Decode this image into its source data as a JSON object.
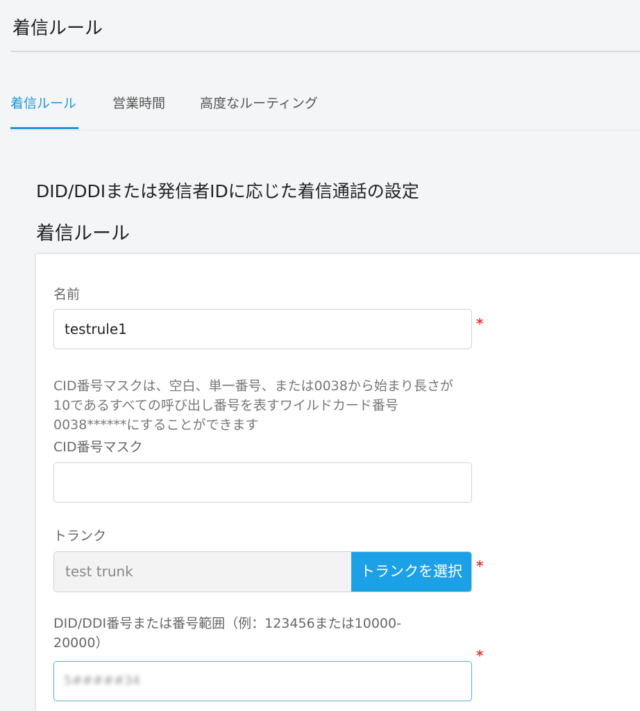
{
  "header": {
    "title": "着信ルール"
  },
  "tabs": [
    {
      "label": "着信ルール",
      "active": true
    },
    {
      "label": "営業時間",
      "active": false
    },
    {
      "label": "高度なルーティング",
      "active": false
    }
  ],
  "section": {
    "description": "DID/DDIまたは発信者IDに応じた着信通話の設定",
    "title": "着信ルール"
  },
  "form": {
    "name": {
      "label": "名前",
      "value": "testrule1",
      "required_mark": "*"
    },
    "cid": {
      "help": "CID番号マスクは、空白、単一番号、または0038から始まり長さが10であるすべての呼び出し番号を表すワイルドカード番号0038******にすることができます",
      "label": "CID番号マスク",
      "value": ""
    },
    "trunk": {
      "label": "トランク",
      "value": "test trunk",
      "button_label": "トランクを選択",
      "required_mark": "*"
    },
    "did": {
      "label": "DID/DDI番号または番号範囲（例：123456または10000-20000）",
      "value": "5#####34",
      "required_mark": "*"
    }
  },
  "colors": {
    "accent": "#1f97d8",
    "button": "#1da1e6",
    "required": "#e53935"
  }
}
